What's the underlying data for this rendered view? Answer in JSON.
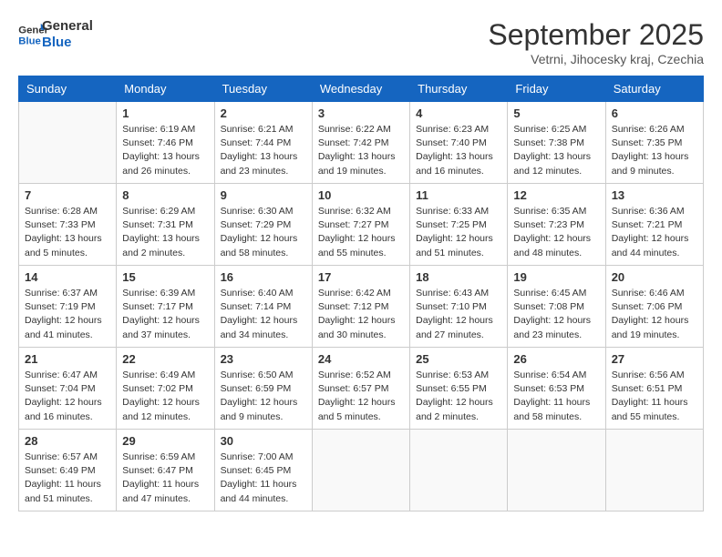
{
  "header": {
    "logo_line1": "General",
    "logo_line2": "Blue",
    "month": "September 2025",
    "location": "Vetrni, Jihocesky kraj, Czechia"
  },
  "days_of_week": [
    "Sunday",
    "Monday",
    "Tuesday",
    "Wednesday",
    "Thursday",
    "Friday",
    "Saturday"
  ],
  "weeks": [
    [
      {
        "day": "",
        "info": ""
      },
      {
        "day": "1",
        "info": "Sunrise: 6:19 AM\nSunset: 7:46 PM\nDaylight: 13 hours\nand 26 minutes."
      },
      {
        "day": "2",
        "info": "Sunrise: 6:21 AM\nSunset: 7:44 PM\nDaylight: 13 hours\nand 23 minutes."
      },
      {
        "day": "3",
        "info": "Sunrise: 6:22 AM\nSunset: 7:42 PM\nDaylight: 13 hours\nand 19 minutes."
      },
      {
        "day": "4",
        "info": "Sunrise: 6:23 AM\nSunset: 7:40 PM\nDaylight: 13 hours\nand 16 minutes."
      },
      {
        "day": "5",
        "info": "Sunrise: 6:25 AM\nSunset: 7:38 PM\nDaylight: 13 hours\nand 12 minutes."
      },
      {
        "day": "6",
        "info": "Sunrise: 6:26 AM\nSunset: 7:35 PM\nDaylight: 13 hours\nand 9 minutes."
      }
    ],
    [
      {
        "day": "7",
        "info": "Sunrise: 6:28 AM\nSunset: 7:33 PM\nDaylight: 13 hours\nand 5 minutes."
      },
      {
        "day": "8",
        "info": "Sunrise: 6:29 AM\nSunset: 7:31 PM\nDaylight: 13 hours\nand 2 minutes."
      },
      {
        "day": "9",
        "info": "Sunrise: 6:30 AM\nSunset: 7:29 PM\nDaylight: 12 hours\nand 58 minutes."
      },
      {
        "day": "10",
        "info": "Sunrise: 6:32 AM\nSunset: 7:27 PM\nDaylight: 12 hours\nand 55 minutes."
      },
      {
        "day": "11",
        "info": "Sunrise: 6:33 AM\nSunset: 7:25 PM\nDaylight: 12 hours\nand 51 minutes."
      },
      {
        "day": "12",
        "info": "Sunrise: 6:35 AM\nSunset: 7:23 PM\nDaylight: 12 hours\nand 48 minutes."
      },
      {
        "day": "13",
        "info": "Sunrise: 6:36 AM\nSunset: 7:21 PM\nDaylight: 12 hours\nand 44 minutes."
      }
    ],
    [
      {
        "day": "14",
        "info": "Sunrise: 6:37 AM\nSunset: 7:19 PM\nDaylight: 12 hours\nand 41 minutes."
      },
      {
        "day": "15",
        "info": "Sunrise: 6:39 AM\nSunset: 7:17 PM\nDaylight: 12 hours\nand 37 minutes."
      },
      {
        "day": "16",
        "info": "Sunrise: 6:40 AM\nSunset: 7:14 PM\nDaylight: 12 hours\nand 34 minutes."
      },
      {
        "day": "17",
        "info": "Sunrise: 6:42 AM\nSunset: 7:12 PM\nDaylight: 12 hours\nand 30 minutes."
      },
      {
        "day": "18",
        "info": "Sunrise: 6:43 AM\nSunset: 7:10 PM\nDaylight: 12 hours\nand 27 minutes."
      },
      {
        "day": "19",
        "info": "Sunrise: 6:45 AM\nSunset: 7:08 PM\nDaylight: 12 hours\nand 23 minutes."
      },
      {
        "day": "20",
        "info": "Sunrise: 6:46 AM\nSunset: 7:06 PM\nDaylight: 12 hours\nand 19 minutes."
      }
    ],
    [
      {
        "day": "21",
        "info": "Sunrise: 6:47 AM\nSunset: 7:04 PM\nDaylight: 12 hours\nand 16 minutes."
      },
      {
        "day": "22",
        "info": "Sunrise: 6:49 AM\nSunset: 7:02 PM\nDaylight: 12 hours\nand 12 minutes."
      },
      {
        "day": "23",
        "info": "Sunrise: 6:50 AM\nSunset: 6:59 PM\nDaylight: 12 hours\nand 9 minutes."
      },
      {
        "day": "24",
        "info": "Sunrise: 6:52 AM\nSunset: 6:57 PM\nDaylight: 12 hours\nand 5 minutes."
      },
      {
        "day": "25",
        "info": "Sunrise: 6:53 AM\nSunset: 6:55 PM\nDaylight: 12 hours\nand 2 minutes."
      },
      {
        "day": "26",
        "info": "Sunrise: 6:54 AM\nSunset: 6:53 PM\nDaylight: 11 hours\nand 58 minutes."
      },
      {
        "day": "27",
        "info": "Sunrise: 6:56 AM\nSunset: 6:51 PM\nDaylight: 11 hours\nand 55 minutes."
      }
    ],
    [
      {
        "day": "28",
        "info": "Sunrise: 6:57 AM\nSunset: 6:49 PM\nDaylight: 11 hours\nand 51 minutes."
      },
      {
        "day": "29",
        "info": "Sunrise: 6:59 AM\nSunset: 6:47 PM\nDaylight: 11 hours\nand 47 minutes."
      },
      {
        "day": "30",
        "info": "Sunrise: 7:00 AM\nSunset: 6:45 PM\nDaylight: 11 hours\nand 44 minutes."
      },
      {
        "day": "",
        "info": ""
      },
      {
        "day": "",
        "info": ""
      },
      {
        "day": "",
        "info": ""
      },
      {
        "day": "",
        "info": ""
      }
    ]
  ]
}
